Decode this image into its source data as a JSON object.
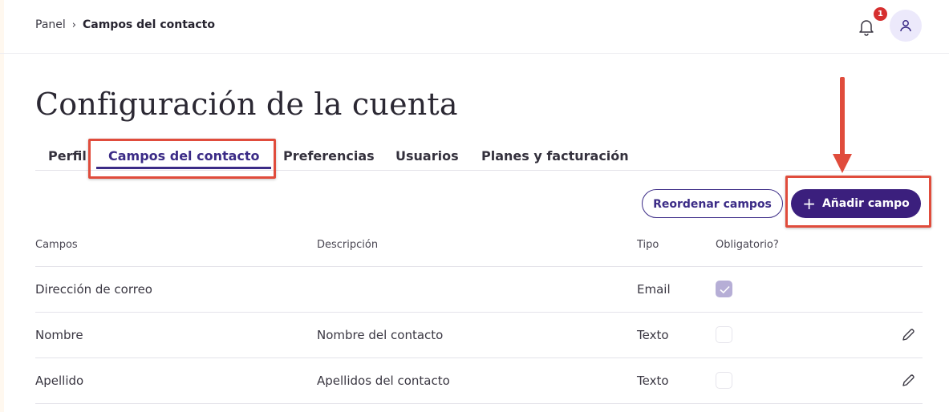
{
  "breadcrumb": {
    "root": "Panel",
    "separator": "›",
    "current": "Campos del contacto"
  },
  "notifications": {
    "count": "1",
    "icon": "bell-icon"
  },
  "user": {
    "icon": "user-icon"
  },
  "page": {
    "title": "Configuración de la cuenta"
  },
  "tabs": [
    {
      "label": "Perfil",
      "active": false
    },
    {
      "label": "Campos del contacto",
      "active": true
    },
    {
      "label": "Preferencias",
      "active": false
    },
    {
      "label": "Usuarios",
      "active": false
    },
    {
      "label": "Planes y facturación",
      "active": false
    }
  ],
  "actions": {
    "reorder_label": "Reordenar campos",
    "add_label": "Añadir campo",
    "add_icon": "+"
  },
  "table": {
    "headers": {
      "field": "Campos",
      "description": "Descripción",
      "type": "Tipo",
      "required": "Obligatorio?"
    },
    "rows": [
      {
        "field": "Dirección de correo",
        "description": "",
        "type": "Email",
        "required": true,
        "editable": false
      },
      {
        "field": "Nombre",
        "description": "Nombre del contacto",
        "type": "Texto",
        "required": false,
        "editable": true
      },
      {
        "field": "Apellido",
        "description": "Apellidos del contacto",
        "type": "Texto",
        "required": false,
        "editable": true
      }
    ]
  },
  "colors": {
    "accent": "#3b1f7d",
    "highlight": "#e04c3c",
    "badge": "#d62f2f"
  }
}
